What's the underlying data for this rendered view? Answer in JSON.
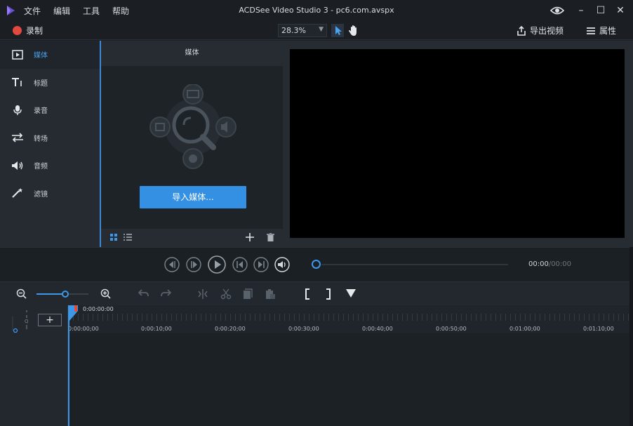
{
  "window": {
    "title": "ACDSee Video Studio 3 - pc6.com.avspx",
    "menu": [
      "文件",
      "编辑",
      "工具",
      "帮助"
    ]
  },
  "toolbar": {
    "record_label": "录制",
    "zoom_value": "28.3%",
    "export_label": "导出视频",
    "properties_label": "属性"
  },
  "sidebar": {
    "items": [
      {
        "label": "媒体",
        "icon": "media-icon",
        "active": true
      },
      {
        "label": "标题",
        "icon": "title-icon"
      },
      {
        "label": "录音",
        "icon": "microphone-icon"
      },
      {
        "label": "转场",
        "icon": "transition-icon"
      },
      {
        "label": "音频",
        "icon": "audio-icon"
      },
      {
        "label": "滤镜",
        "icon": "filter-wand-icon"
      }
    ]
  },
  "media_panel": {
    "header": "媒体",
    "import_label": "导入媒体..."
  },
  "transport": {
    "current": "00:00",
    "duration": "/00:00"
  },
  "timeline": {
    "playhead_time": "0:00:00:00",
    "ruler": [
      "0:00:00;00",
      "0:00:10;00",
      "0:00:20;00",
      "0:00:30;00",
      "0:00:40;00",
      "0:00:50;00",
      "0:01:00;00",
      "0:01:10;00"
    ],
    "zoom_level": 0.55
  },
  "colors": {
    "accent": "#3490e3",
    "record": "#e24a3f"
  }
}
